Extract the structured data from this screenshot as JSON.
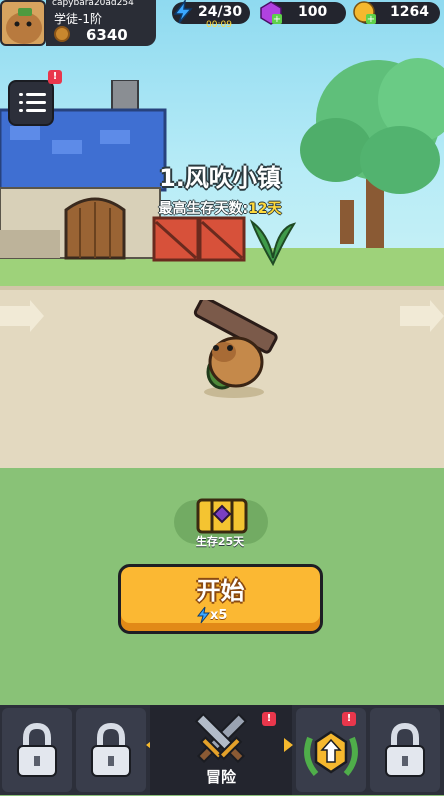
{
  "hud": {
    "player_name": "capybara20ad254",
    "player_rank": "学徒-1阶",
    "power": "6340",
    "energy": "24/30",
    "energy_timer": "00:09",
    "gems": "100",
    "coins": "1264"
  },
  "menu": {
    "badge": "!"
  },
  "level": {
    "title": "1.风吹小镇",
    "best_days_label": "最高生存天数:",
    "best_days_value": "12天"
  },
  "chest": {
    "label": "生存25天"
  },
  "start": {
    "label": "开始",
    "cost": "x5"
  },
  "bottom_nav": {
    "adventure_label": "冒险",
    "badge": "!"
  }
}
